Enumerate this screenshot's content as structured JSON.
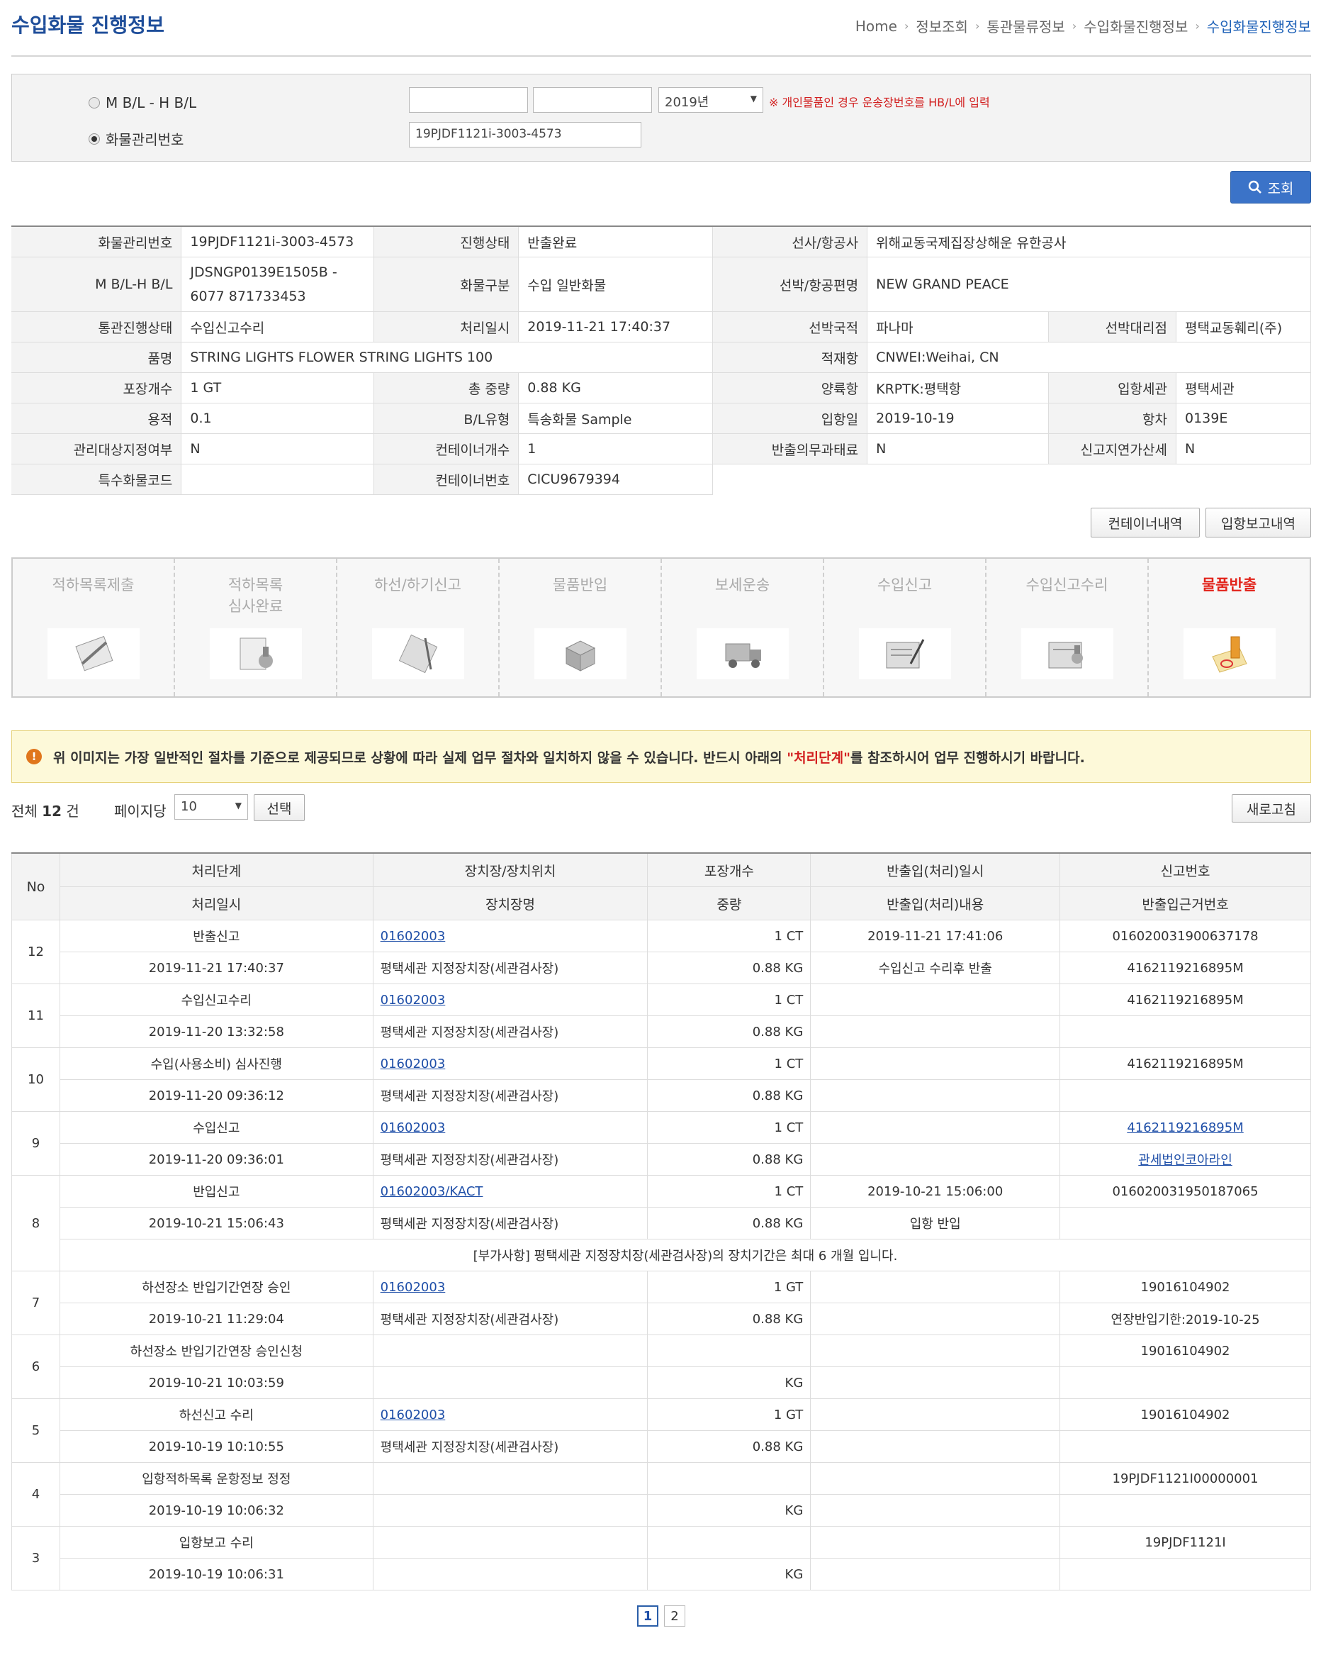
{
  "header": {
    "title": "수입화물 진행정보",
    "breadcrumb": [
      "Home",
      "정보조회",
      "통관물류정보",
      "수입화물진행정보",
      "수입화물진행정보"
    ]
  },
  "search": {
    "radio_mbl": "M B/L - H B/L",
    "radio_cargo": "화물관리번호",
    "year_value": "2019년",
    "note": "※ 개인물품인 경우 운송장번호를 HB/L에 입력",
    "cargo_value": "19PJDF1121i-3003-4573",
    "button": "조회"
  },
  "info": {
    "rows": [
      [
        [
          "화물관리번호",
          "19PJDF1121i-3003-4573"
        ],
        [
          "진행상태",
          "반출완료"
        ],
        [
          "선사/항공사",
          "위해교동국제집장상해운 유한공사"
        ]
      ],
      [
        [
          "M B/L-H B/L",
          "JDSNGP0139E1505B - 6077 871733453"
        ],
        [
          "화물구분",
          "수입 일반화물"
        ],
        [
          "선박/항공편명",
          "NEW GRAND PEACE"
        ]
      ],
      [
        [
          "통관진행상태",
          "수입신고수리"
        ],
        [
          "처리일시",
          "2019-11-21 17:40:37"
        ],
        [
          "선박국적",
          "파나마"
        ],
        [
          "선박대리점",
          "평택교동훼리(주)"
        ]
      ],
      [
        [
          "품명",
          "STRING LIGHTS FLOWER STRING LIGHTS 100"
        ],
        [
          "적재항",
          "CNWEI:Weihai, CN"
        ]
      ],
      [
        [
          "포장개수",
          "1 GT"
        ],
        [
          "총 중량",
          "0.88 KG"
        ],
        [
          "양륙항",
          "KRPTK:평택항"
        ],
        [
          "입항세관",
          "평택세관"
        ]
      ],
      [
        [
          "용적",
          "0.1"
        ],
        [
          "B/L유형",
          "특송화물 Sample"
        ],
        [
          "입항일",
          "2019-10-19"
        ],
        [
          "항차",
          "0139E"
        ]
      ],
      [
        [
          "관리대상지정여부",
          "N"
        ],
        [
          "컨테이너개수",
          "1"
        ],
        [
          "반출의무과태료",
          "N"
        ],
        [
          "신고지연가산세",
          "N"
        ]
      ],
      [
        [
          "특수화물코드",
          ""
        ],
        [
          "컨테이너번호",
          "CICU9679394"
        ]
      ]
    ]
  },
  "buttons": {
    "container": "컨테이너내역",
    "arrival": "입항보고내역",
    "refresh": "새로고침",
    "select": "선택"
  },
  "steps": [
    {
      "label": "적하목록제출",
      "icon": "clipboard-icon"
    },
    {
      "label": "적하목록\n심사완료",
      "icon": "stamp-icon"
    },
    {
      "label": "하선/하기신고",
      "icon": "notebook-icon"
    },
    {
      "label": "물품반입",
      "icon": "boxes-icon"
    },
    {
      "label": "보세운송",
      "icon": "truck-icon"
    },
    {
      "label": "수입신고",
      "icon": "document-pen-icon"
    },
    {
      "label": "수입신고수리",
      "icon": "document-approve-icon"
    },
    {
      "label": "물품반출",
      "icon": "seal-stamp-icon",
      "active": true
    }
  ],
  "notice": {
    "pre": "위 이미지는 가장 일반적인 절차를 기준으로 제공되므로 상황에 따라 실제 업무 절차와 일치하지 않을 수 있습니다. 반드시 아래의 ",
    "highlight": "\"처리단계\"",
    "post": "를 참조하시어 업무 진행하시기 바랍니다."
  },
  "list_meta": {
    "total_label": "전체",
    "total_count": "12",
    "total_unit": "건",
    "per_page_label": "페이지당",
    "per_page_value": "10"
  },
  "list": {
    "headers_top": [
      "No",
      "처리단계",
      "장치장/장치위치",
      "포장개수",
      "반출입(처리)일시",
      "신고번호"
    ],
    "headers_bottom": [
      "처리일시",
      "장치장명",
      "중량",
      "반출입(처리)내용",
      "반출입근거번호"
    ],
    "rows": [
      {
        "no": "12",
        "stage": "반출신고",
        "loc": "01602003",
        "pkg": "1 CT",
        "io_dt": "2019-11-21 17:41:06",
        "report": "016020031900637178",
        "dt": "2019-11-21 17:40:37",
        "loc_name": "평택세관 지정장치장(세관검사장)",
        "weight": "0.88 KG",
        "io_desc": "수입신고 수리후 반출",
        "basis": "4162119216895M"
      },
      {
        "no": "11",
        "stage": "수입신고수리",
        "loc": "01602003",
        "pkg": "1 CT",
        "io_dt": "",
        "report": "4162119216895M",
        "dt": "2019-11-20 13:32:58",
        "loc_name": "평택세관 지정장치장(세관검사장)",
        "weight": "0.88 KG",
        "io_desc": "",
        "basis": ""
      },
      {
        "no": "10",
        "stage": "수입(사용소비) 심사진행",
        "loc": "01602003",
        "pkg": "1 CT",
        "io_dt": "",
        "report": "4162119216895M",
        "dt": "2019-11-20 09:36:12",
        "loc_name": "평택세관 지정장치장(세관검사장)",
        "weight": "0.88 KG",
        "io_desc": "",
        "basis": ""
      },
      {
        "no": "9",
        "stage": "수입신고",
        "loc": "01602003",
        "pkg": "1 CT",
        "io_dt": "",
        "report": "4162119216895M",
        "report_link": true,
        "dt": "2019-11-20 09:36:01",
        "loc_name": "평택세관 지정장치장(세관검사장)",
        "weight": "0.88 KG",
        "io_desc": "",
        "basis": "관세법인코아라인",
        "basis_link": true
      },
      {
        "no": "8",
        "stage": "반입신고",
        "loc": "01602003/KACT",
        "pkg": "1 CT",
        "io_dt": "2019-10-21 15:06:00",
        "report": "016020031950187065",
        "dt": "2019-10-21 15:06:43",
        "loc_name": "평택세관 지정장치장(세관검사장)",
        "weight": "0.88 KG",
        "io_desc": "입항 반입",
        "basis": "",
        "extra": "[부가사항] 평택세관 지정장치장(세관검사장)의 장치기간은 최대 6 개월 입니다."
      },
      {
        "no": "7",
        "stage": "하선장소 반입기간연장 승인",
        "loc": "01602003",
        "pkg": "1 GT",
        "io_dt": "",
        "report": "19016104902",
        "dt": "2019-10-21 11:29:04",
        "loc_name": "평택세관 지정장치장(세관검사장)",
        "weight": "0.88 KG",
        "io_desc": "",
        "basis": "연장반입기한:2019-10-25"
      },
      {
        "no": "6",
        "stage": "하선장소 반입기간연장 승인신청",
        "loc": "",
        "pkg": "",
        "io_dt": "",
        "report": "19016104902",
        "dt": "2019-10-21 10:03:59",
        "loc_name": "",
        "weight": "KG",
        "io_desc": "",
        "basis": ""
      },
      {
        "no": "5",
        "stage": "하선신고 수리",
        "loc": "01602003",
        "pkg": "1 GT",
        "io_dt": "",
        "report": "19016104902",
        "dt": "2019-10-19 10:10:55",
        "loc_name": "평택세관 지정장치장(세관검사장)",
        "weight": "0.88 KG",
        "io_desc": "",
        "basis": ""
      },
      {
        "no": "4",
        "stage": "입항적하목록 운항정보 정정",
        "loc": "",
        "pkg": "",
        "io_dt": "",
        "report": "19PJDF1121I00000001",
        "dt": "2019-10-19 10:06:32",
        "loc_name": "",
        "weight": "KG",
        "io_desc": "",
        "basis": ""
      },
      {
        "no": "3",
        "stage": "입항보고 수리",
        "loc": "",
        "pkg": "",
        "io_dt": "",
        "report": "19PJDF1121I",
        "dt": "2019-10-19 10:06:31",
        "loc_name": "",
        "weight": "KG",
        "io_desc": "",
        "basis": ""
      }
    ]
  },
  "pager": [
    "1",
    "2"
  ]
}
